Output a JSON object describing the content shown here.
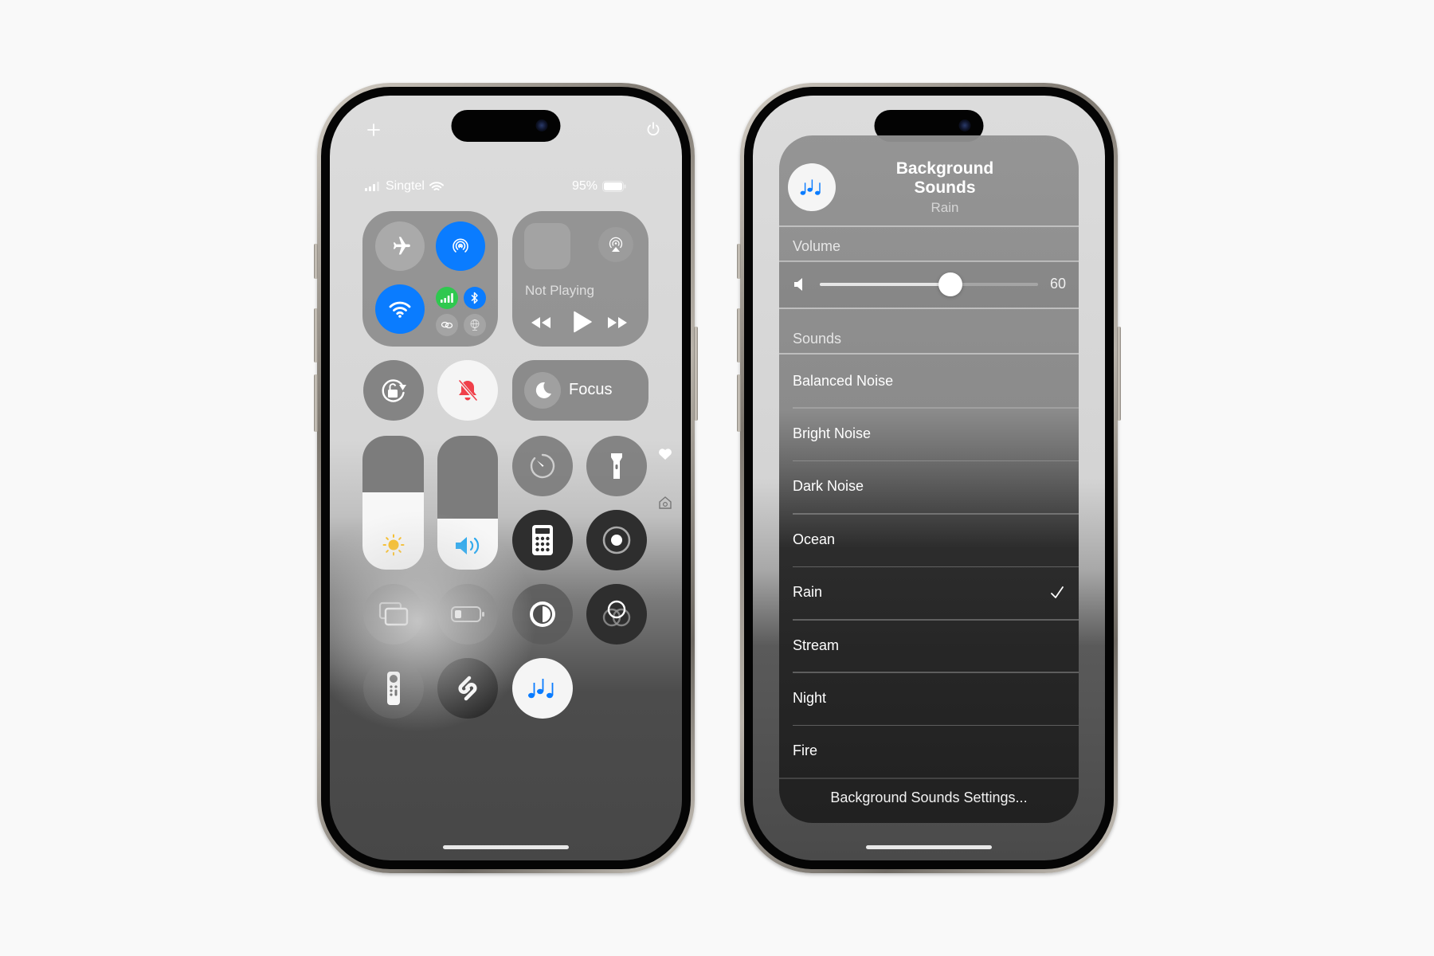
{
  "phone_left": {
    "top_controls": {
      "add_icon": "plus-icon",
      "power_icon": "power-icon"
    },
    "status_bar": {
      "carrier": "Singtel",
      "battery": "95%"
    },
    "connectivity": {
      "airplane": {
        "icon": "airplane-icon",
        "on": false
      },
      "airdrop": {
        "icon": "airdrop-icon",
        "on": true
      },
      "wifi": {
        "icon": "wifi-icon",
        "on": true
      },
      "cellular": {
        "icon": "cellular-icon",
        "on": true
      },
      "bluetooth": {
        "icon": "bluetooth-icon",
        "on": true
      },
      "personal_hotspot": {
        "icon": "link-icon",
        "on": false
      },
      "vpn": {
        "icon": "globe-icon",
        "on": false
      }
    },
    "media": {
      "status": "Not Playing",
      "airplay_icon": "airplay-icon"
    },
    "focus": {
      "label": "Focus",
      "icon": "moon-icon"
    },
    "brightness_level": 0.58,
    "volume_level": 0.38,
    "colors": {
      "blue": "#0a7cff",
      "green": "#2fc84f",
      "red": "#f0404a",
      "yellow": "#fdbb10"
    }
  },
  "phone_right": {
    "header": {
      "title": "Background Sounds",
      "subtitle": "Rain",
      "icon": "music-notes-icon"
    },
    "volume": {
      "label": "Volume",
      "value": 60,
      "value_text": "60",
      "max": 100
    },
    "sounds": {
      "label": "Sounds",
      "items": [
        {
          "name": "Balanced Noise",
          "selected": false
        },
        {
          "name": "Bright Noise",
          "selected": false
        },
        {
          "name": "Dark Noise",
          "selected": false
        },
        {
          "name": "Ocean",
          "selected": false
        },
        {
          "name": "Rain",
          "selected": true
        },
        {
          "name": "Stream",
          "selected": false
        },
        {
          "name": "Night",
          "selected": false
        },
        {
          "name": "Fire",
          "selected": false
        }
      ]
    },
    "settings_link": "Background Sounds Settings..."
  }
}
